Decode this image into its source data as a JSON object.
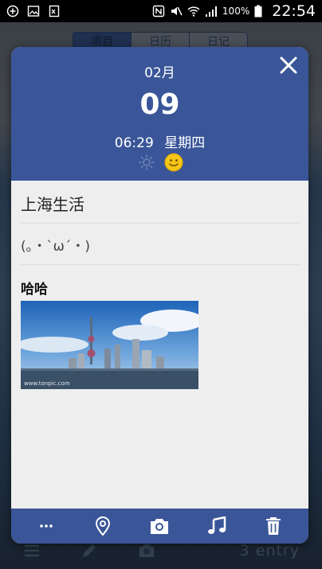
{
  "status_bar": {
    "battery": "100%",
    "time": "22:54"
  },
  "background": {
    "tabs": [
      "项目",
      "日历",
      "日记"
    ],
    "entry_label": "3  entry"
  },
  "dialog": {
    "month": "02月",
    "day": "09",
    "time": "06:29",
    "weekday": "星期四",
    "weather_icon": "sun-icon",
    "mood_icon": "smiley-icon",
    "title": "上海生活",
    "mood_text": "(｡・`ω´・)",
    "note": "哈哈",
    "photo_watermark": "www.tonpic.com"
  },
  "toolbar": [
    "more-icon",
    "location-icon",
    "camera-icon",
    "music-icon",
    "trash-icon"
  ],
  "colors": {
    "accent": "#3a5699",
    "body": "#eeeeee",
    "smiley": "#f5c518"
  }
}
